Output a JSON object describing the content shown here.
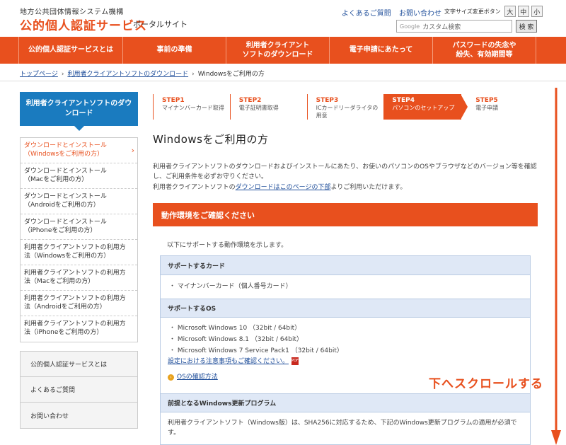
{
  "header": {
    "org": "地方公共団体情報システム機構",
    "brand": "公的個人認証サービス",
    "brand_sub": "ポータルサイト",
    "links": [
      "よくあるご質問",
      "お問い合わせ"
    ],
    "font_size_label": "文字サイズ変更ボタン",
    "font_sizes": [
      "大",
      "中",
      "小"
    ],
    "search_google": "Google",
    "search_placeholder": "カスタム検索",
    "search_button": "検 索"
  },
  "nav": [
    "公的個人認証サービスとは",
    "事前の準備",
    "利用者クライアント\nソフトのダウンロード",
    "電子申請にあたって",
    "パスワードの失念や\n紛失、有効期間等"
  ],
  "breadcrumb": [
    "トップページ",
    "利用者クライアントソフトのダウンロード",
    "Windowsをご利用の方"
  ],
  "sidebar": {
    "heading": "利用者クライアントソフトのダウンロード",
    "items": [
      "ダウンロードとインストール\n（Windowsをご利用の方）",
      "ダウンロードとインストール\n（Macをご利用の方）",
      "ダウンロードとインストール\n（Androidをご利用の方）",
      "ダウンロードとインストール\n（iPhoneをご利用の方）",
      "利用者クライアントソフトの利用方\n法（Windowsをご利用の方）",
      "利用者クライアントソフトの利用方\n法（Macをご利用の方）",
      "利用者クライアントソフトの利用方\n法（Androidをご利用の方）",
      "利用者クライアントソフトの利用方\n法（iPhoneをご利用の方）"
    ],
    "box_items": [
      "公的個人認証サービスとは",
      "よくあるご質問",
      "お問い合わせ"
    ]
  },
  "steps": [
    {
      "num": "STEP1",
      "label": "マイナンバーカード取得"
    },
    {
      "num": "STEP2",
      "label": "電子証明書取得"
    },
    {
      "num": "STEP3",
      "label": "ICカードリーダライタの\n用意"
    },
    {
      "num": "STEP4",
      "label": "パソコンのセットアップ"
    },
    {
      "num": "STEP5",
      "label": "電子申請"
    }
  ],
  "main": {
    "title": "Windowsをご利用の方",
    "intro_1": "利用者クライアントソフトのダウンロードおよびインストールにあたり、お使いのパソコンのOSやブラウザなどのバージョン等を確認し、ご利用条件を必ずお守りください。",
    "intro_2a": "利用者クライアントソフトの",
    "intro_2_link": "ダウンロードはこのページの下部",
    "intro_2b": "よりご利用いただけます。",
    "section_title": "動作環境をご確認ください",
    "support_intro": "以下にサポートする動作環境を示します。",
    "card_head": "サポートするカード",
    "card_item": "・ マイナンバーカード（個人番号カード）",
    "os_head": "サポートするOS",
    "os_items": [
      "・ Microsoft Windows 10 （32bit / 64bit）",
      "・ Microsoft Windows 8.1 （32bit / 64bit）",
      "・ Microsoft Windows 7 Service Pack1 （32bit / 64bit）"
    ],
    "os_note_link": "設定における注意事項もご確認ください。",
    "pdf_label": "PDF",
    "os_check_link": "OSの確認方法",
    "update_head": "前提となるWindows更新プログラム",
    "update_text": "利用者クライアントソフト（Windows版）は、SHA256に対応するため、下記のWindows更新プログラムの適用が必須です。"
  },
  "scroll_hint": "下へスクロールする",
  "colors": {
    "accent": "#e8501e",
    "sidebar_head": "#1a7bbf",
    "table_head": "#dfe8f6",
    "link": "#1f4e9a"
  }
}
